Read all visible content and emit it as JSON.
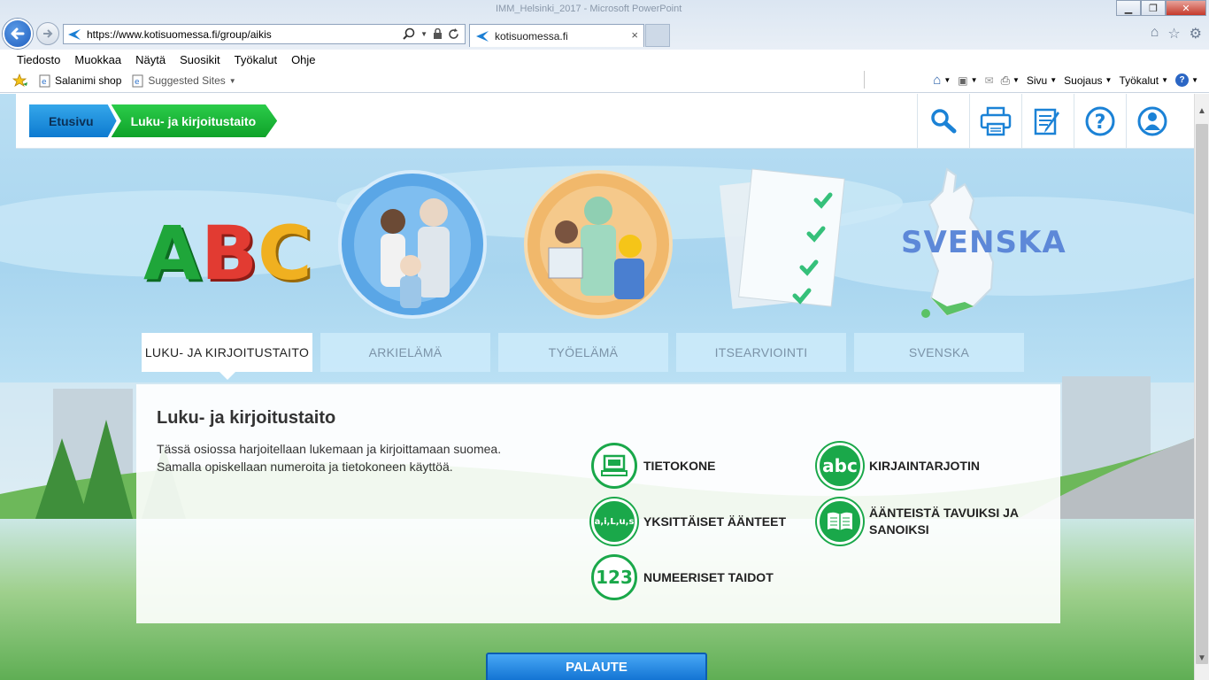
{
  "browser": {
    "title_ghost": "IMM_Helsinki_2017 - Microsoft PowerPoint",
    "address_prefix": "https://www.",
    "address_domain": "kotisuomessa.fi",
    "address_path": "/group/aikis",
    "tab_title": "kotisuomessa.fi",
    "tab_close": "×",
    "minimize": "▁",
    "maximize": "❐",
    "close": "✕"
  },
  "menu": [
    "Tiedosto",
    "Muokkaa",
    "Näytä",
    "Suosikit",
    "Työkalut",
    "Ohje"
  ],
  "favorites": {
    "item1": "Salanimi shop",
    "item2": "Suggested Sites"
  },
  "commandbar": {
    "page": "Sivu",
    "safety": "Suojaus",
    "tools": "Työkalut"
  },
  "breadcrumb": {
    "home": "Etusivu",
    "current": "Luku- ja kirjoitustaito"
  },
  "header_icons": [
    "search-icon",
    "print-icon",
    "notes-icon",
    "help-icon",
    "profile-icon"
  ],
  "illustrations": {
    "abc_letters": [
      "A",
      "B",
      "C"
    ],
    "svenska_text": "SVENSKA"
  },
  "categories": [
    "LUKU- JA KIRJOITUSTAITO",
    "ARKIELÄMÄ",
    "TYÖELÄMÄ",
    "ITSEARVIOINTI",
    "SVENSKA"
  ],
  "panel": {
    "title": "Luku- ja kirjoitustaito",
    "desc_line1": "Tässä osiossa harjoitellaan lukemaan ja kirjoittamaan suomea.",
    "desc_line2": "Samalla opiskellaan numeroita ja tietokoneen käyttöä.",
    "options": {
      "computer": "TIETOKONE",
      "keyboard": "KIRJAINTARJOTIN",
      "sounds": "YKSITTÄISET ÄÄNTEET",
      "syllables_line1": "ÄÄNTEISTÄ TAVUIKSI JA",
      "syllables_line2": "SANOIKSI",
      "numbers": "NUMEERISET TAIDOT"
    },
    "icon_text": {
      "abc": "abc",
      "sounds": "a,i,L,u,s",
      "numbers": "123"
    }
  },
  "feedback": "PALAUTE",
  "colors": {
    "green": "#1aa84a",
    "blue": "#0d7ad0",
    "sky": "#b9def3"
  }
}
